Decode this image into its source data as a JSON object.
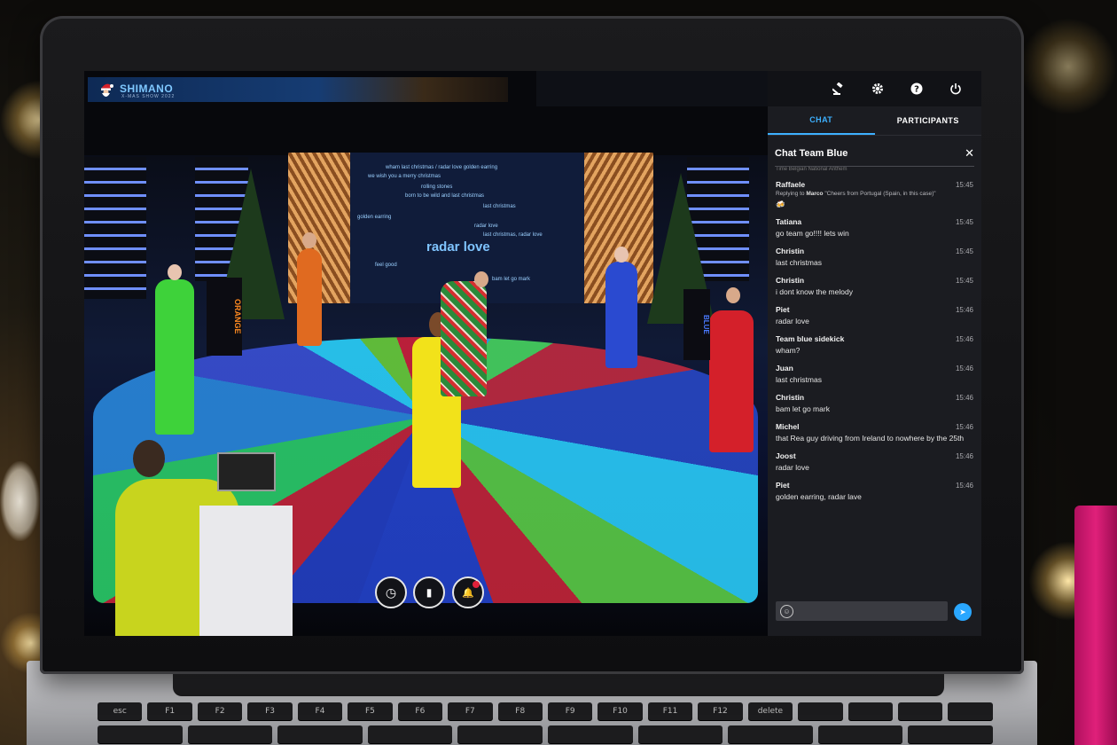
{
  "brand": {
    "name": "SHIMANO",
    "subtitle": "X-MAS SHOW 2022"
  },
  "word_cloud": {
    "featured": "radar love",
    "phrases": [
      "wham last christmas / radar love golden earring",
      "we wish you a merry christmas",
      "rolling stones",
      "born to be wild and last christmas",
      "last christmas",
      "golden earring",
      "radar love",
      "last christmas, radar love",
      "feel good",
      "bam let go mark"
    ]
  },
  "podium_labels": {
    "left": "ORANGE",
    "right": "BLUE"
  },
  "video_controls": [
    {
      "name": "clock-icon",
      "glyph": "◷"
    },
    {
      "name": "layout-icon",
      "glyph": "▮"
    },
    {
      "name": "bell-icon",
      "glyph": "🔔"
    }
  ],
  "topbar_icons": [
    "gavel-icon",
    "gear-icon",
    "help-icon",
    "power-icon"
  ],
  "tabs": [
    {
      "label": "CHAT",
      "active": true
    },
    {
      "label": "PARTICIPANTS",
      "active": false
    }
  ],
  "chat": {
    "title": "Chat Team Blue",
    "truncated_line": "Time Belgian National Anthem",
    "messages": [
      {
        "author": "Raffaele",
        "time": "15:45",
        "reply_prefix": "Replying to",
        "reply_to": "Marco",
        "reply_text": "\"Cheers from Portugal (Spain, in this case)\"",
        "text": "🍻"
      },
      {
        "author": "Tatiana",
        "time": "15:45",
        "text": "go team go!!!! lets win"
      },
      {
        "author": "Christin",
        "time": "15:45",
        "text": "last christmas"
      },
      {
        "author": "Christin",
        "time": "15:45",
        "text": "i dont know the melody"
      },
      {
        "author": "Piet",
        "time": "15:46",
        "text": "radar love"
      },
      {
        "author": "Team blue sidekick",
        "time": "15:46",
        "text": "wham?"
      },
      {
        "author": "Juan",
        "time": "15:46",
        "text": "last christmas"
      },
      {
        "author": "Christin",
        "time": "15:46",
        "text": "bam let go mark"
      },
      {
        "author": "Michel",
        "time": "15:46",
        "text": "that Rea guy driving from Ireland to nowhere by the 25th"
      },
      {
        "author": "Joost",
        "time": "15:46",
        "text": "radar love"
      },
      {
        "author": "Piet",
        "time": "15:46",
        "text": "golden earring, radar lave"
      }
    ],
    "composer_placeholder": ""
  },
  "keyboard": [
    "esc",
    "F1",
    "F2",
    "F3",
    "F4",
    "F5",
    "F6",
    "F7",
    "F8",
    "F9",
    "F10",
    "F11",
    "F12",
    "delete"
  ],
  "colors": {
    "accent": "#3db0ff",
    "panel_bg": "#1b1c21",
    "send": "#2aa7ff"
  }
}
